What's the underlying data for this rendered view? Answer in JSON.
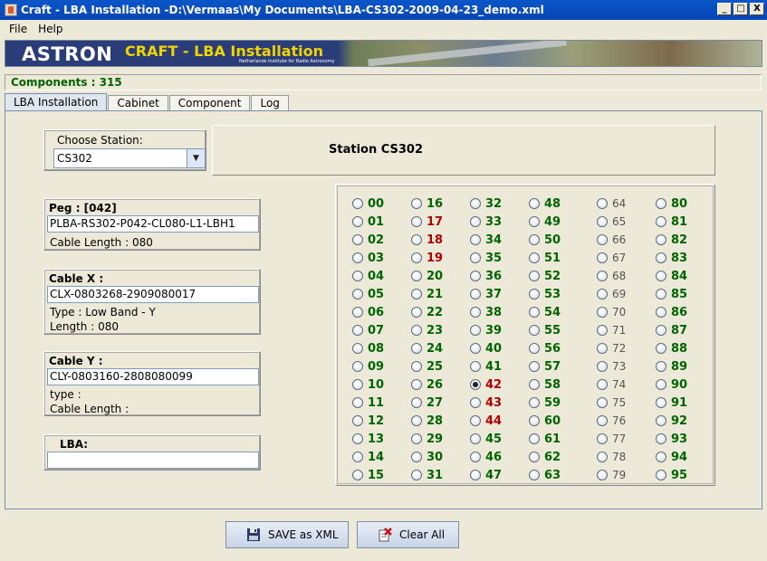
{
  "window": {
    "title": "Craft - LBA Installation -D:\\Vermaas\\My Documents\\LBA-CS302-2009-04-23_demo.xml",
    "buttons": [
      "_",
      "□",
      "X"
    ]
  },
  "menu": [
    "File",
    "Help"
  ],
  "banner": {
    "logo": "ASTRON",
    "subtitle": "CRAFT - LBA Installation",
    "tagline": "Netherlands Institute for Radio Astronomy"
  },
  "status": "Components : 315",
  "tabs": [
    "LBA Installation",
    "Cabinet",
    "Component",
    "Log"
  ],
  "station_chooser": {
    "label": "Choose Station:",
    "value": "CS302"
  },
  "station_header": "Station CS302",
  "peg": {
    "header": "Peg : [042]",
    "value": "PLBA-RS302-P042-CL080-L1-LBH1",
    "cable_length": "Cable Length : 080"
  },
  "cable_x": {
    "header": "Cable X :",
    "value": "CLX-0803268-2909080017",
    "type": "Type : Low Band - Y",
    "length": "Length : 080"
  },
  "cable_y": {
    "header": "Cable Y :",
    "value": "CLY-0803160-2808080099",
    "type": "type :",
    "cable_length": "Cable Length :"
  },
  "lba": {
    "header": "LBA:",
    "value": ""
  },
  "antenna_grid": {
    "columns": [
      [
        "00",
        "01",
        "02",
        "03",
        "04",
        "05",
        "06",
        "07",
        "08",
        "09",
        "10",
        "11",
        "12",
        "13",
        "14",
        "15"
      ],
      [
        "16",
        "17",
        "18",
        "19",
        "20",
        "21",
        "22",
        "23",
        "24",
        "25",
        "26",
        "27",
        "28",
        "29",
        "30",
        "31"
      ],
      [
        "32",
        "33",
        "34",
        "35",
        "36",
        "37",
        "38",
        "39",
        "40",
        "41",
        "42",
        "43",
        "44",
        "45",
        "46",
        "47"
      ],
      [
        "48",
        "49",
        "50",
        "51",
        "52",
        "53",
        "54",
        "55",
        "56",
        "57",
        "58",
        "59",
        "60",
        "61",
        "62",
        "63"
      ],
      [
        "64",
        "65",
        "66",
        "67",
        "68",
        "69",
        "70",
        "71",
        "72",
        "73",
        "74",
        "75",
        "76",
        "77",
        "78",
        "79"
      ],
      [
        "80",
        "81",
        "82",
        "83",
        "84",
        "85",
        "86",
        "87",
        "88",
        "89",
        "90",
        "91",
        "92",
        "93",
        "94",
        "95"
      ]
    ],
    "red": [
      "17",
      "18",
      "19",
      "42",
      "43",
      "44"
    ],
    "plain": [
      "64",
      "65",
      "66",
      "67",
      "68",
      "69",
      "70",
      "71",
      "72",
      "73",
      "74",
      "75",
      "76",
      "77",
      "78",
      "79"
    ],
    "selected": "42",
    "colors": {
      "green": "#006400",
      "red": "#b00000",
      "plain": "#555555"
    }
  },
  "buttons": {
    "save": "SAVE as XML",
    "clear": "Clear All"
  },
  "icons": {
    "save": "floppy-disk-icon",
    "clear": "clear-icon"
  }
}
